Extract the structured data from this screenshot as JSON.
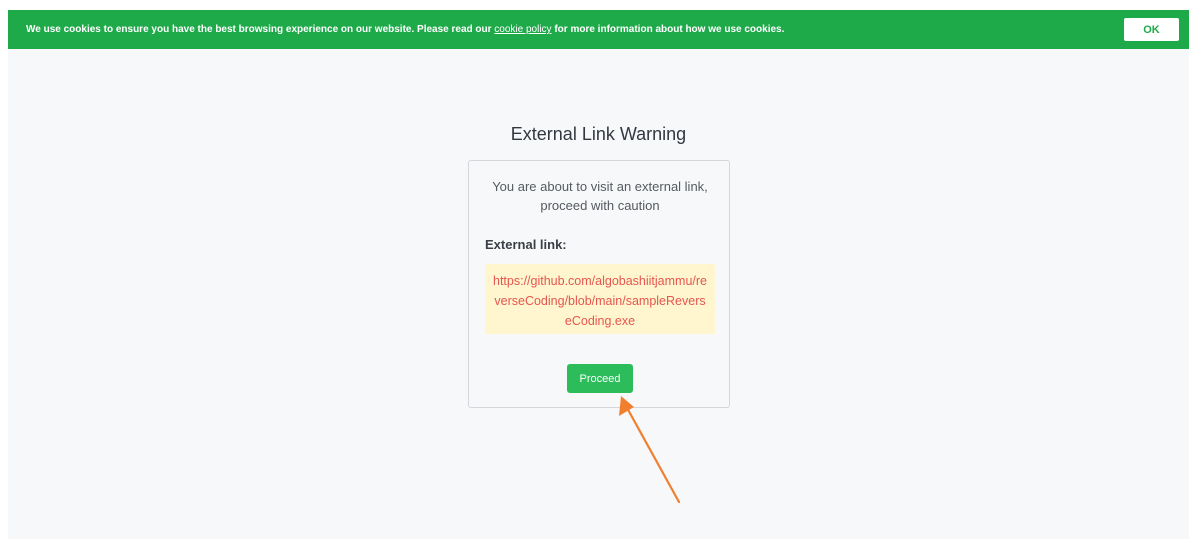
{
  "cookie_banner": {
    "text_before": "We use cookies to ensure you have the best browsing experience on our website. Please read our ",
    "link_text": "cookie policy",
    "text_after": " for more information about how we use cookies.",
    "ok_label": "OK"
  },
  "page": {
    "title": "External Link Warning",
    "message": "You are about to visit an external link, proceed with caution",
    "link_label": "External link:",
    "external_url": "https://github.com/algobashiitjammu/reverseCoding/blob/main/sampleReverseCoding.exe",
    "proceed_label": "Proceed"
  },
  "colors": {
    "banner_green": "#1faa4a",
    "button_green": "#2cbd5a",
    "url_text": "#e4574f",
    "url_highlight": "#fff5cf",
    "annotation_arrow": "#f08030"
  },
  "icons": {
    "annotation": "arrow-pointer-icon"
  }
}
